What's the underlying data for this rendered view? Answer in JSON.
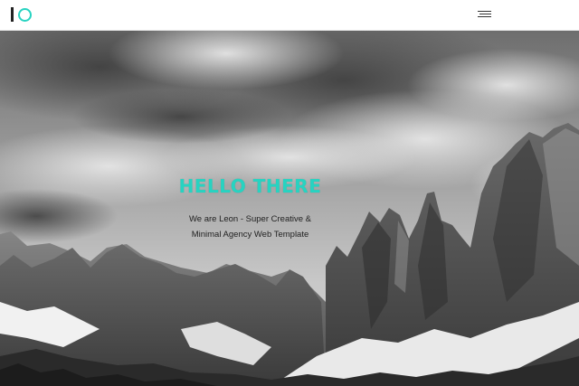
{
  "colors": {
    "accent": "#27d3c1",
    "header_bg": "#ffffff",
    "text_dark": "#222222"
  },
  "header": {
    "logo_icon": "logo-mark-icon",
    "menu_icon": "hamburger-menu-icon"
  },
  "hero": {
    "background": "monochrome-mountain-landscape",
    "title": "HELLO THERE",
    "subtitle_line1": "We are Leon - Super Creative &",
    "subtitle_line2": "Minimal Agency Web Template"
  }
}
